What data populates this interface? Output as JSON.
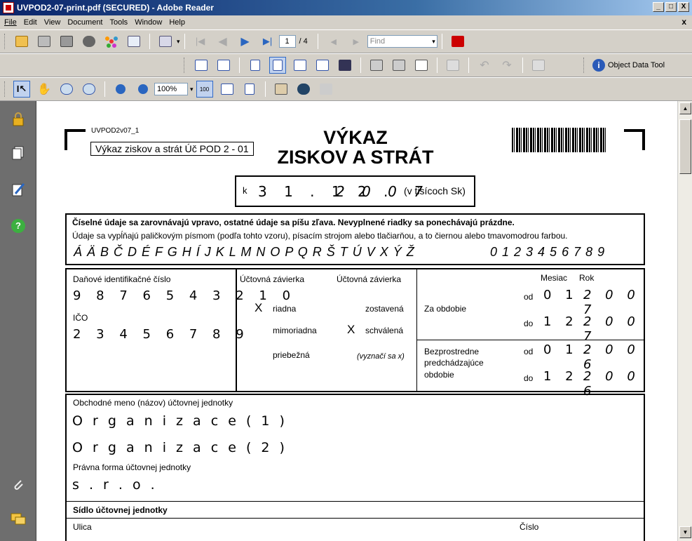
{
  "window": {
    "title": "UVPOD2-07-print.pdf (SECURED) - Adobe Reader",
    "min_label": "_",
    "max_label": "□",
    "close_label": "X",
    "doc_close_label": "x"
  },
  "menu": [
    "File",
    "Edit",
    "View",
    "Document",
    "Tools",
    "Window",
    "Help"
  ],
  "toolbar": {
    "page_current": "1",
    "page_total": "/ 4",
    "find_placeholder": "Find",
    "zoom": "100%",
    "object_data_tool": "Object Data Tool"
  },
  "form": {
    "form_code": "UVPOD2v07_1",
    "form_name": "Výkaz ziskov a strát Úč POD 2 - 01",
    "title_line1": "VÝKAZ",
    "title_line2": "ZISKOV A STRÁT",
    "date_prefix": "k",
    "date_value_day_month": "3 1 . 1 2 .",
    "date_value_year": "2 0 0 7",
    "date_unit": "(v tisícoch Sk)",
    "instructions_bold": "Číselné údaje sa zarovnávajú vpravo, ostatné údaje sa píšu zľava. Nevyplnené riadky sa ponechávajú prázdne.",
    "instructions_normal": "Údaje sa vypĺňajú paličkovým písmom (podľa tohto vzoru), písacím strojom alebo tlačiarňou, a to čiernou alebo tmavomodrou farbou.",
    "sample_letters": "Á Ä B Č D É F G H Í J K L M N O P Q R Š T Ú V X Ý Ž",
    "sample_digits": "0 1 2 3 4 5 6 7 8 9",
    "dic_label": "Daňové identifikačné číslo",
    "dic_value": "9 8 7 6 5 4 3 2 1 0",
    "ico_label": "IČO",
    "ico_value": "2 3 4 5 6 7 8 9",
    "uz1_label": "Účtovná závierka",
    "uz2_label": "Účtovná závierka",
    "riadna_mark": "X",
    "riadna_label": "riadna",
    "zostavena_label": "zostavená",
    "mimoriadna_label": "mimoriadna",
    "schvalena_mark": "X",
    "schvalena_label": "schválená",
    "priebezna_label": "priebežná",
    "vyznaci_label": "(vyznačí sa x)",
    "mesiac_label": "Mesiac",
    "rok_label": "Rok",
    "za_obdobie_label": "Za obdobie",
    "od_label": "od",
    "do_label": "do",
    "za_od_month": "0 1",
    "za_od_year": "2 0 0 7",
    "za_do_month": "1 2",
    "za_do_year": "2 0 0 7",
    "bezpr_label_1": "Bezprostredne",
    "bezpr_label_2": "predchádzajúce",
    "bezpr_label_3": "obdobie",
    "bp_od_month": "0 1",
    "bp_od_year": "2 0 0 6",
    "bp_do_month": "1 2",
    "bp_do_year": "2 0 0 6",
    "obch_meno_label": "Obchodné meno (názov) účtovnej jednotky",
    "obch_meno_line1": "O r g a n i z a c e ( 1 )",
    "obch_meno_line2": "O r g a n i z a c e ( 2 )",
    "pravna_forma_label": "Právna forma účtovnej jednotky",
    "pravna_forma_value": "s . r . o .",
    "sidlo_label": "Sídlo účtovnej jednotky",
    "ulica_label": "Ulica",
    "cislo_label": "Číslo"
  }
}
